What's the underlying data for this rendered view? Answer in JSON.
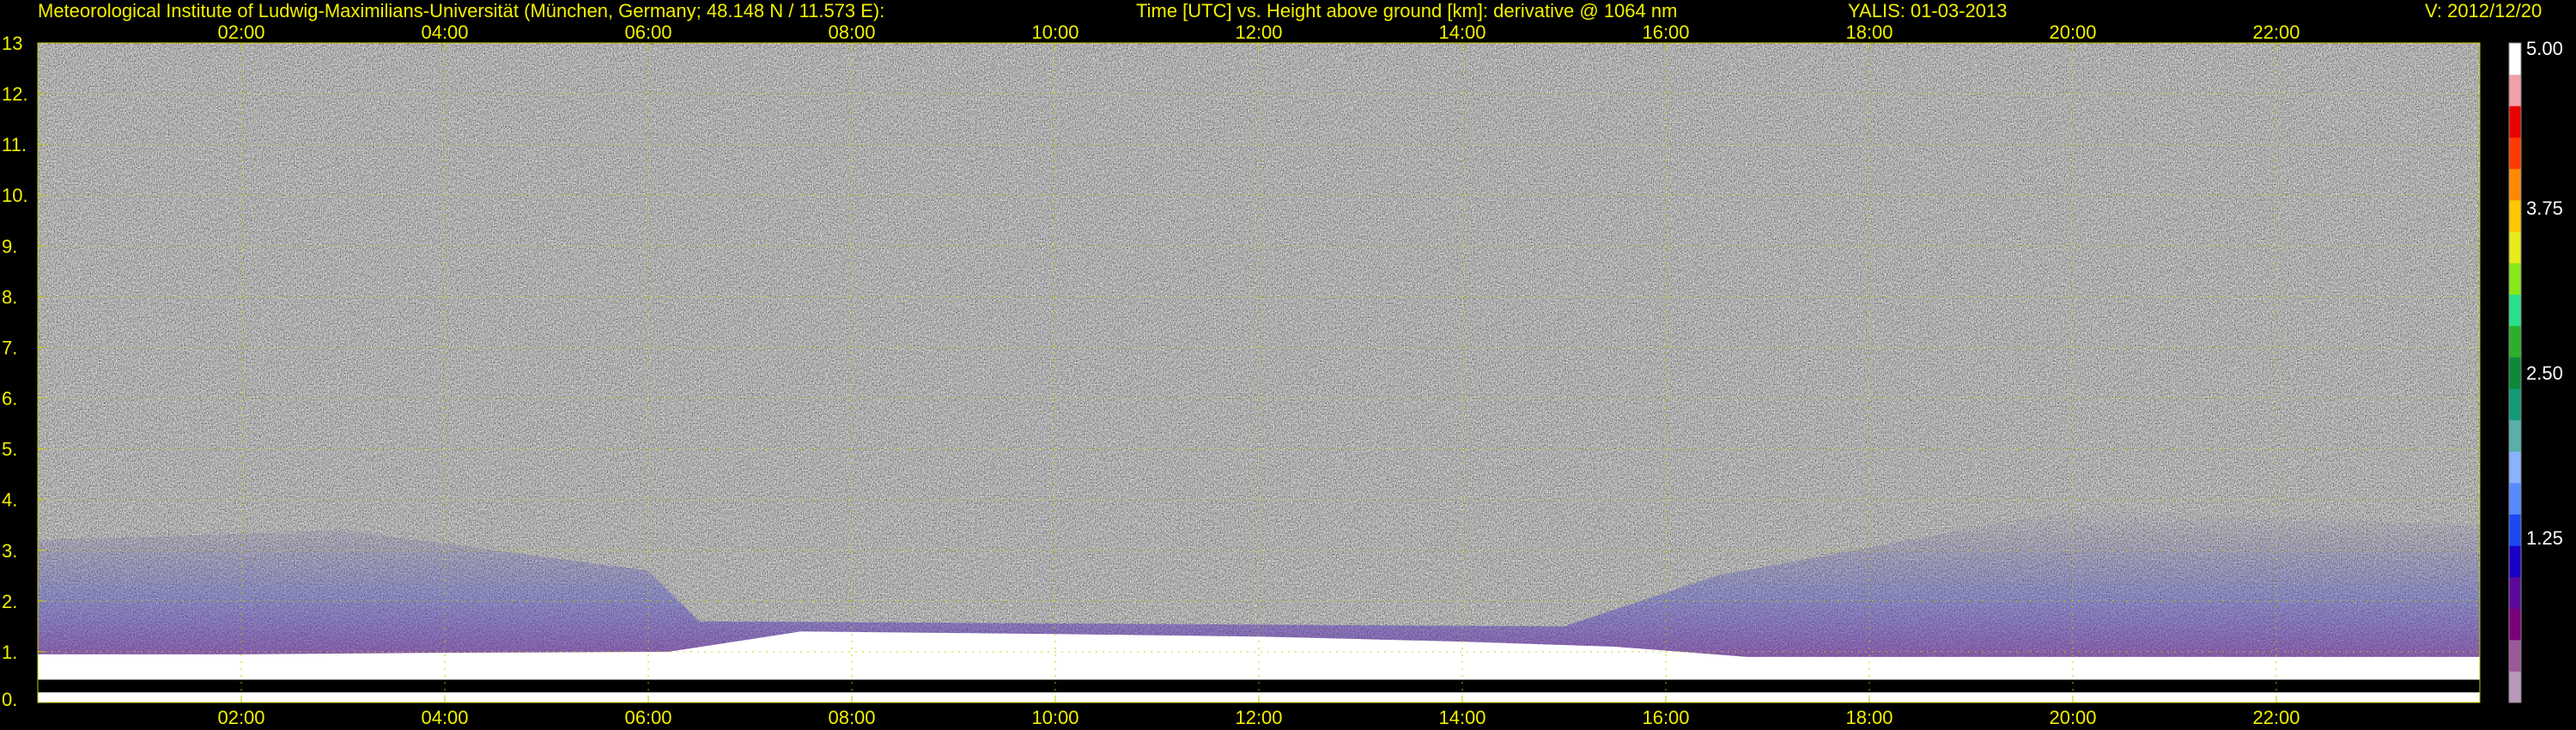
{
  "header": {
    "institute": "Meteorological Institute of Ludwig-Maximilians-Universität (München, Germany; 48.148 N / 11.573 E):",
    "description": "Time [UTC] vs. Height above ground [km]: derivative @ 1064 nm",
    "station_date": "YALIS: 01-03-2013",
    "version": "V: 2012/12/20"
  },
  "colors": {
    "text": "#f2f000",
    "grid": "#c8c800",
    "background": "#000000"
  },
  "chart_data": {
    "type": "heatmap",
    "title": "Time [UTC] vs. Height above ground [km]: derivative @ 1064 nm",
    "xlabel": "Time [UTC]",
    "ylabel": "Height above ground [km]",
    "xlim": [
      0,
      24
    ],
    "ylim": [
      0,
      13
    ],
    "x_ticks": [
      2,
      4,
      6,
      8,
      10,
      12,
      14,
      16,
      18,
      20,
      22
    ],
    "x_tick_labels": [
      "02:00",
      "04:00",
      "06:00",
      "08:00",
      "10:00",
      "12:00",
      "14:00",
      "16:00",
      "18:00",
      "20:00",
      "22:00"
    ],
    "y_ticks": [
      0,
      1,
      2,
      3,
      4,
      5,
      6,
      7,
      8,
      9,
      10,
      11,
      12,
      13
    ],
    "y_tick_labels": [
      "0.",
      "1.",
      "2.",
      "3.",
      "4.",
      "5.",
      "6.",
      "7.",
      "8.",
      "9.",
      "10.",
      "11.",
      "12.",
      "13"
    ],
    "grid": true,
    "colorbar": {
      "range": [
        0,
        5
      ],
      "ticks": [
        1.25,
        2.5,
        3.75,
        5
      ],
      "tick_labels": [
        "1.25",
        "2.50",
        "3.75",
        "5.00"
      ],
      "colors": [
        "#b89ab8",
        "#9a5a9a",
        "#7a007a",
        "#5a0a9a",
        "#1a00c8",
        "#1a4af0",
        "#5a8aff",
        "#8ab2ff",
        "#58b0a8",
        "#129a78",
        "#0a8a3a",
        "#2ab02a",
        "#2ae08a",
        "#8ae81a",
        "#e8ea1a",
        "#ffc800",
        "#ff8a00",
        "#ff3a00",
        "#e80000",
        "#f0a0a8",
        "#ffffff"
      ]
    },
    "features": {
      "boundary_layer_top_km": [
        {
          "time": 0.0,
          "height": 0.95
        },
        {
          "time": 2.0,
          "height": 0.95
        },
        {
          "time": 4.0,
          "height": 0.98
        },
        {
          "time": 6.2,
          "height": 1.0
        },
        {
          "time": 7.5,
          "height": 1.4
        },
        {
          "time": 10.0,
          "height": 1.35
        },
        {
          "time": 12.0,
          "height": 1.3
        },
        {
          "time": 14.0,
          "height": 1.2
        },
        {
          "time": 15.5,
          "height": 1.1
        },
        {
          "time": 16.8,
          "height": 0.9
        },
        {
          "time": 17.0,
          "height": 0.9
        },
        {
          "time": 24.0,
          "height": 0.9
        }
      ],
      "aerosol_layer_top_km": [
        {
          "time": 0.0,
          "height": 3.2
        },
        {
          "time": 3.0,
          "height": 3.4
        },
        {
          "time": 6.0,
          "height": 2.6
        },
        {
          "time": 6.5,
          "height": 1.6
        },
        {
          "time": 15.0,
          "height": 1.5
        },
        {
          "time": 16.5,
          "height": 2.5
        },
        {
          "time": 20.0,
          "height": 3.8
        },
        {
          "time": 24.0,
          "height": 3.5
        }
      ]
    }
  }
}
